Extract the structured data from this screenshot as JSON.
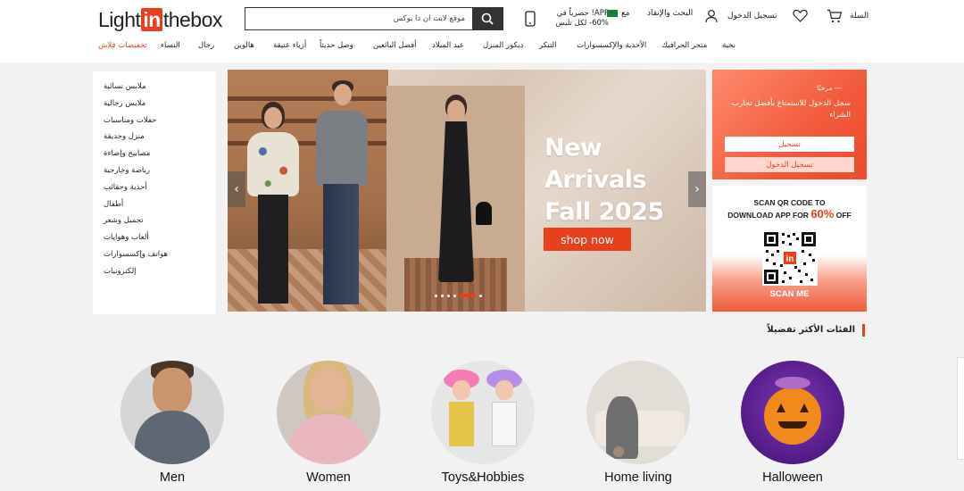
{
  "header": {
    "logo": {
      "part1": "Light",
      "part2": "in",
      "part3": "thebox"
    },
    "search_placeholder": "موقع لايت ان ذا بوكس",
    "app_promo": "APP! حصرياً في\n60%- لكل تليس",
    "flag_label": "مع",
    "help_label": "البحث والإنقاذ",
    "account_label": "تسجيل الدخول",
    "cart_label": "السلة"
  },
  "nav": [
    "نخبة",
    "متجر الجرافيك",
    "الأحذية والإكسسوارات",
    "التنكر",
    "ديكور المنزل",
    "عيد الميلاد",
    "أفضل البائعين",
    "وصل حديثاً",
    "أزياء عتيقة",
    "هالوين",
    "رجال",
    "النساء",
    "تخفيضات فلاش"
  ],
  "sidebar": [
    "ملابس نسائية",
    "ملابس رجالية",
    "حفلات ومناسبات",
    "منزل وحديقة",
    "مصابيح وإضاءة",
    "رياضة وخارجية",
    "أحذية وحقائب",
    "أطفال",
    "تجميل وشعر",
    "ألعاب وهوايات",
    "هواتف وإكسسوارات",
    "إلكترونيات"
  ],
  "banner": {
    "line1": "New Arrivals",
    "line2": "Fall 2025",
    "cta": "shop now"
  },
  "login_box": {
    "hello": "--- مرحبًا",
    "message": "سجل الدخول للاستمتاع بأفضل تجارب الشراء",
    "register": "تسجيل",
    "sign_in": "تسجيل الدخول"
  },
  "qr_box": {
    "line1": "SCAN QR CODE TO",
    "line2_pre": "DOWNLOAD APP FOR ",
    "line2_pct": "60%",
    "line2_post": " OFF",
    "scan": "SCAN ME"
  },
  "section_title": "الفئات الأكثر تفضيلاً",
  "categories": [
    "Men",
    "Women",
    "Toys&Hobbies",
    "Home living",
    "Halloween"
  ],
  "colors": {
    "accent": "#e8401c",
    "dark": "#333333"
  }
}
